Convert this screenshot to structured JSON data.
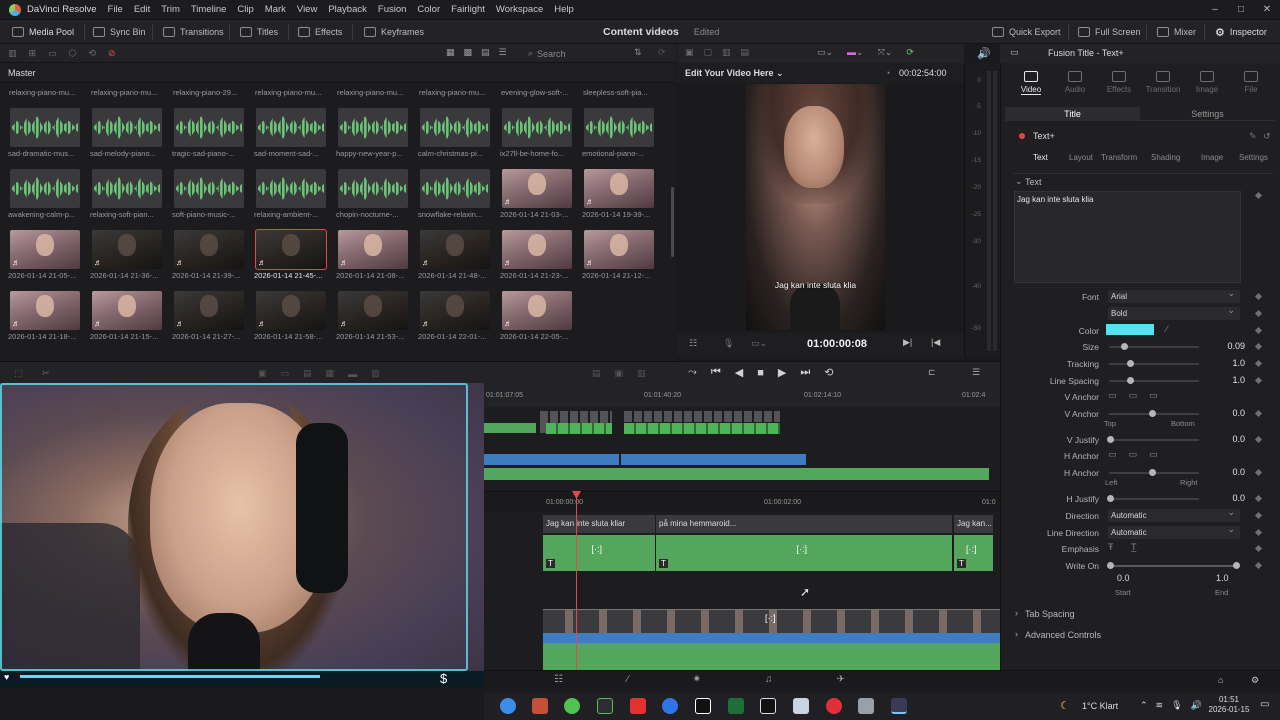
{
  "app": {
    "title": "DaVinci Resolve",
    "menu": [
      "File",
      "Edit",
      "Trim",
      "Timeline",
      "Clip",
      "Mark",
      "View",
      "Playback",
      "Fusion",
      "Color",
      "Fairlight",
      "Workspace",
      "Help"
    ]
  },
  "toolbar": {
    "media_pool": "Media Pool",
    "sync_bin": "Sync Bin",
    "transitions": "Transitions",
    "titles": "Titles",
    "effects": "Effects",
    "keyframes": "Keyframes",
    "project_name": "Content videos",
    "project_status": "Edited",
    "quick_export": "Quick Export",
    "full_screen": "Full Screen",
    "mixer": "Mixer",
    "inspector": "Inspector"
  },
  "media_pool": {
    "search_placeholder": "Search",
    "bin": "Master",
    "top_labels": [
      "relaxing-piano-mu...",
      "relaxing-piano-mu...",
      "relaxing-piano-29...",
      "relaxing-piano-mu...",
      "relaxing-piano-mu...",
      "relaxing-piano-mu...",
      "evening-glow-soft-...",
      "sleepless-soft-pia..."
    ],
    "clips": [
      {
        "label": "sad-dramatic-mus...",
        "kind": "audio"
      },
      {
        "label": "sad-melody-piano...",
        "kind": "audio"
      },
      {
        "label": "tragic-sad-piano-...",
        "kind": "audio"
      },
      {
        "label": "sad-moment-sad-...",
        "kind": "audio"
      },
      {
        "label": "happy-new-year-p...",
        "kind": "audio"
      },
      {
        "label": "calm-christmas-pi...",
        "kind": "audio"
      },
      {
        "label": "ix27ll-be-home-fo...",
        "kind": "audio"
      },
      {
        "label": "emotional-piano-...",
        "kind": "audio"
      },
      {
        "label": "awakening-calm-p...",
        "kind": "audio"
      },
      {
        "label": "relaxing-soft-pian...",
        "kind": "audio"
      },
      {
        "label": "soft-piano-music-...",
        "kind": "audio"
      },
      {
        "label": "relaxing-ambient-...",
        "kind": "audio"
      },
      {
        "label": "chopin-nocturne-...",
        "kind": "audio"
      },
      {
        "label": "snowflake-relaxin...",
        "kind": "audio"
      },
      {
        "label": "2026-01-14 21-03-...",
        "kind": "video"
      },
      {
        "label": "2026-01-14 19-39-...",
        "kind": "video"
      },
      {
        "label": "2026-01-14 21-05-...",
        "kind": "video"
      },
      {
        "label": "2026-01-14 21-36-...",
        "kind": "dark"
      },
      {
        "label": "2026-01-14 21-39-...",
        "kind": "dark"
      },
      {
        "label": "2026-01-14 21-45-...",
        "kind": "dark",
        "selected": true
      },
      {
        "label": "2026-01-14 21-08-...",
        "kind": "video"
      },
      {
        "label": "2026-01-14 21-48-...",
        "kind": "dark"
      },
      {
        "label": "2026-01-14 21-23-...",
        "kind": "video"
      },
      {
        "label": "2026-01-14 21-12-...",
        "kind": "video"
      },
      {
        "label": "2026-01-14 21-18-...",
        "kind": "video"
      },
      {
        "label": "2026-01-14 21-15-...",
        "kind": "video"
      },
      {
        "label": "2026-01-14 21-27-...",
        "kind": "dark"
      },
      {
        "label": "2026-01-14 21-58-...",
        "kind": "dark"
      },
      {
        "label": "2026-01-14 21-53-...",
        "kind": "dark"
      },
      {
        "label": "2026-01-14 22-01-...",
        "kind": "dark"
      },
      {
        "label": "2026-01-14 22-05-...",
        "kind": "video"
      }
    ]
  },
  "viewer": {
    "title": "Edit Your Video Here",
    "duration": "00:02:54:00",
    "subtitle": "Jag kan inte sluta klia",
    "timecode": "01:00:00:08"
  },
  "meter": {
    "scale": [
      "0",
      "-5",
      "-10",
      "-15",
      "-20",
      "-25",
      "-30",
      "-40",
      "-50"
    ]
  },
  "inspector": {
    "header": "Fusion Title - Text+",
    "tabs": [
      "Video",
      "Audio",
      "Effects",
      "Transition",
      "Image",
      "File"
    ],
    "subtabs": [
      "Title",
      "Settings"
    ],
    "node": "Text+",
    "panel_tabs": [
      "Text",
      "Layout",
      "Transform",
      "Shading",
      "Image",
      "Settings"
    ],
    "section": "Text",
    "text_value": "Jag kan inte sluta klia",
    "font": "Arial",
    "style": "Bold",
    "color_label": "Color",
    "color": "#56e3f0",
    "size_label": "Size",
    "size": "0.09",
    "tracking_label": "Tracking",
    "tracking": "1.0",
    "line_spacing_label": "Line Spacing",
    "line_spacing": "1.0",
    "v_anchor_label": "V Anchor",
    "v_anchor": "0.0",
    "v_top": "Top",
    "v_bottom": "Bottom",
    "v_justify_label": "V Justify",
    "v_justify": "0.0",
    "h_anchor_label": "H Anchor",
    "h_anchor": "0.0",
    "h_left": "Left",
    "h_right": "Right",
    "h_justify_label": "H Justify",
    "h_justify": "0.0",
    "direction_label": "Direction",
    "direction": "Automatic",
    "line_direction_label": "Line Direction",
    "line_direction": "Automatic",
    "emphasis_label": "Emphasis",
    "write_on_label": "Write On",
    "write_on_start": "0.0",
    "write_on_end": "1.0",
    "start_label": "Start",
    "end_label": "End",
    "tab_spacing": "Tab Spacing",
    "advanced": "Advanced Controls",
    "font_label": "Font"
  },
  "timeline": {
    "ruler_top": [
      "01:01:07:05",
      "01:01:40:20",
      "01:02:14:10",
      "01:02:4"
    ],
    "ruler_main": [
      "01:00:00:00",
      "01:00:02:00",
      "01:0"
    ],
    "titles": [
      "Jag kan inte sluta kliar",
      "på mina hemmaroid...",
      "Jag kan..."
    ]
  },
  "taskbar": {
    "weather": "1°C  Klart",
    "time": "01:51",
    "date": "2026-01-15"
  }
}
